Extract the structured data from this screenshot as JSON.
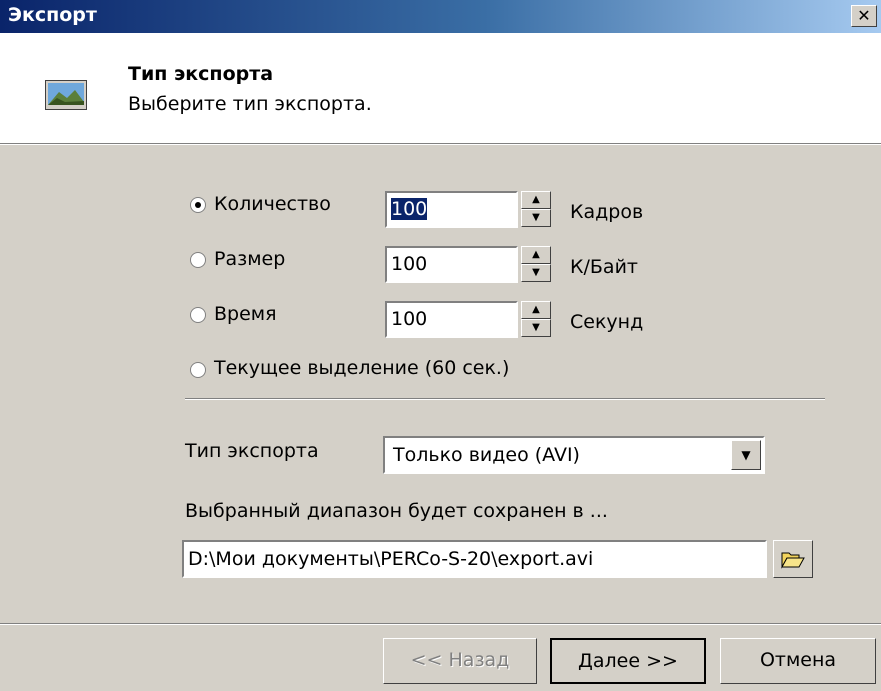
{
  "window": {
    "title": "Экспорт",
    "close_glyph": "✕"
  },
  "header": {
    "title": "Тип экспорта",
    "subtitle": "Выберите тип экспорта.",
    "icon": "landscape-image-icon"
  },
  "limit_options": [
    {
      "label": "Количество",
      "value": "100",
      "unit": "Кадров",
      "checked": true
    },
    {
      "label": "Размер",
      "value": "100",
      "unit": "К/Байт",
      "checked": false
    },
    {
      "label": "Время",
      "value": "100",
      "unit": "Секунд",
      "checked": false
    },
    {
      "label": "Текущее выделение (60 сек.)",
      "checked": false
    }
  ],
  "export_type": {
    "label": "Тип экспорта",
    "selected": "Только видео (AVI)"
  },
  "save_path": {
    "label": "Выбранный диапазон будет сохранен в ...",
    "value": "D:\\Мои документы\\PERCo-S-20\\export.avi"
  },
  "buttons": {
    "back": "<< Назад",
    "next": "Далее >>",
    "cancel": "Отмена"
  }
}
